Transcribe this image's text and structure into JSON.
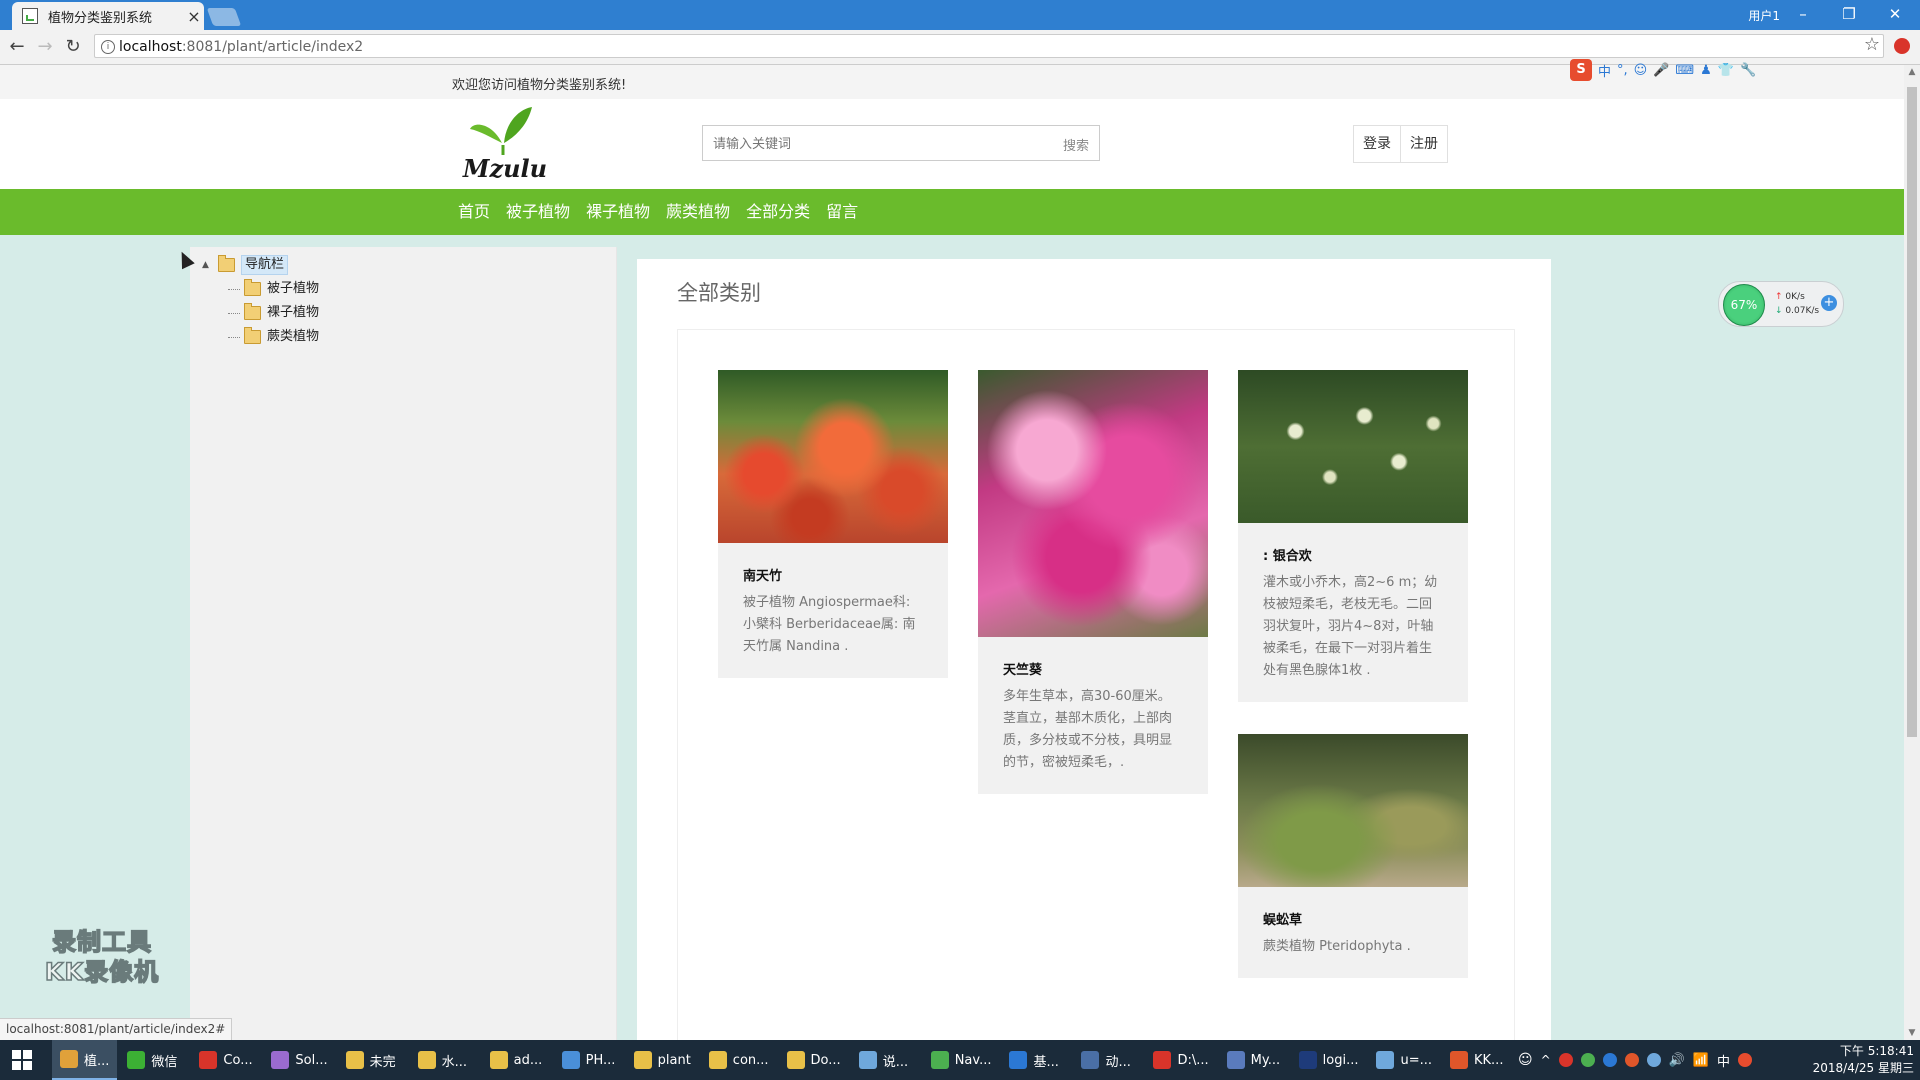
{
  "browser": {
    "tab_title": "植物分类鉴别系统",
    "tab_close": "×",
    "user_label": "用户1",
    "url_host": "localhost",
    "url_rest": ":8081/plant/article/index2",
    "status_url": "localhost:8081/plant/article/index2#"
  },
  "site": {
    "welcome": "欢迎您访问植物分类鉴别系统!",
    "logo_text": "Mzulu",
    "search": {
      "placeholder": "请输入关键词",
      "button": "搜索"
    },
    "auth": {
      "login": "登录",
      "register": "注册"
    },
    "nav": [
      "首页",
      "被子植物",
      "裸子植物",
      "蕨类植物",
      "全部分类",
      "留言"
    ]
  },
  "sidebar": {
    "root": "导航栏",
    "children": [
      "被子植物",
      "裸子植物",
      "蕨类植物"
    ]
  },
  "content": {
    "heading": "全部类别",
    "cards": [
      {
        "title": "南天竹",
        "desc": "被子植物 Angiospermae科: 小檗科 Berberidaceae属: 南天竹属 Nandina ."
      },
      {
        "title": "天竺葵",
        "desc": "多年生草本，高30-60厘米。茎直立，基部木质化，上部肉质，多分枝或不分枝，具明显的节，密被短柔毛，."
      },
      {
        "title": ": 银合欢",
        "desc": "灌木或小乔木，高2~6 m；幼枝被短柔毛，老枝无毛。二回羽状复叶，羽片4~8对，叶轴被柔毛，在最下一对羽片着生处有黑色腺体1枚 ."
      },
      {
        "title": "蜈蚣草",
        "desc": "蕨类植物 Pteridophyta ."
      }
    ]
  },
  "overlays": {
    "watermark_line1": "录制工具",
    "watermark_line2": "KK录像机",
    "netmon_percent": "67%",
    "netmon_up": "0K/s",
    "netmon_down": "0.07K/s"
  },
  "taskbar": {
    "items": [
      {
        "label": "植...",
        "color": "#e0a13a"
      },
      {
        "label": "微信",
        "color": "#3cb034"
      },
      {
        "label": "Co...",
        "color": "#d9342a"
      },
      {
        "label": "Sol...",
        "color": "#9a6bd0"
      },
      {
        "label": "未完",
        "color": "#e8c048"
      },
      {
        "label": "水...",
        "color": "#e8c048"
      },
      {
        "label": "ad...",
        "color": "#e8c048"
      },
      {
        "label": "PH...",
        "color": "#4a8fd8"
      },
      {
        "label": "plant",
        "color": "#e8c048"
      },
      {
        "label": "con...",
        "color": "#e8c048"
      },
      {
        "label": "Do...",
        "color": "#e8c048"
      },
      {
        "label": "说...",
        "color": "#6fa8dc"
      },
      {
        "label": "Nav...",
        "color": "#4caf50"
      },
      {
        "label": "基...",
        "color": "#2b78d4"
      },
      {
        "label": "动...",
        "color": "#4a6fa5"
      },
      {
        "label": "D:\\...",
        "color": "#d9342a"
      },
      {
        "label": "My...",
        "color": "#5a7bbd"
      },
      {
        "label": "logi...",
        "color": "#1e3b7a"
      },
      {
        "label": "u=...",
        "color": "#6fa8dc"
      },
      {
        "label": "KK...",
        "color": "#e0562a"
      }
    ],
    "tray_ime": "中",
    "time": "下午 5:18:41",
    "date": "2018/4/25 星期三"
  }
}
